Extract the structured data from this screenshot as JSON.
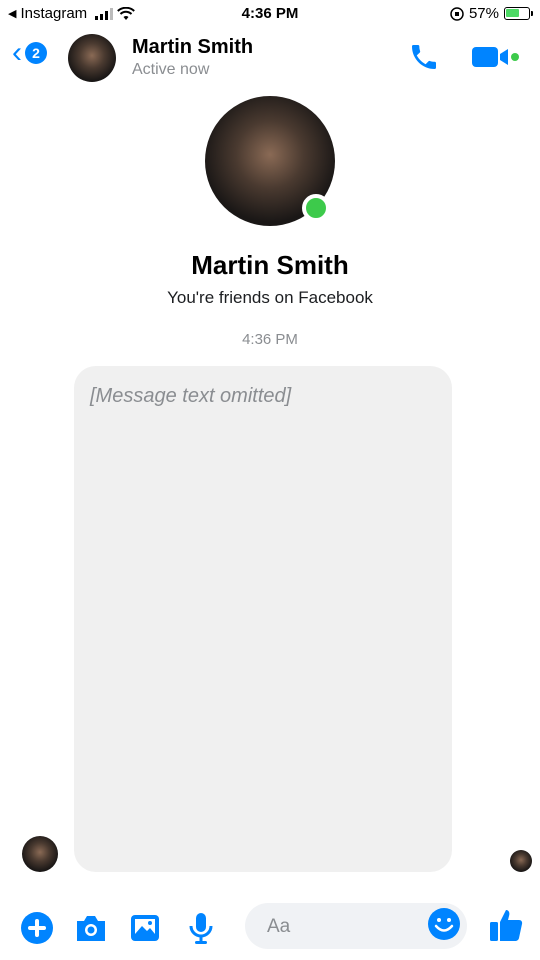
{
  "status_bar": {
    "back_app": "Instagram",
    "time": "4:36 PM",
    "battery": "57%"
  },
  "header": {
    "unread_count": "2",
    "name": "Martin Smith",
    "presence": "Active now",
    "accent": "#0084ff"
  },
  "profile": {
    "name": "Martin Smith",
    "relationship": "You're friends on Facebook",
    "online_color": "#3dca4b"
  },
  "thread": {
    "timestamp": "4:36 PM",
    "message_placeholder": "[Message text omitted]"
  },
  "composer": {
    "placeholder": "Aa"
  },
  "icons": [
    "back-chevron-icon",
    "phone-icon",
    "video-camera-icon",
    "plus-icon",
    "camera-icon",
    "image-icon",
    "microphone-icon",
    "emoji-icon",
    "thumbs-up-icon"
  ]
}
